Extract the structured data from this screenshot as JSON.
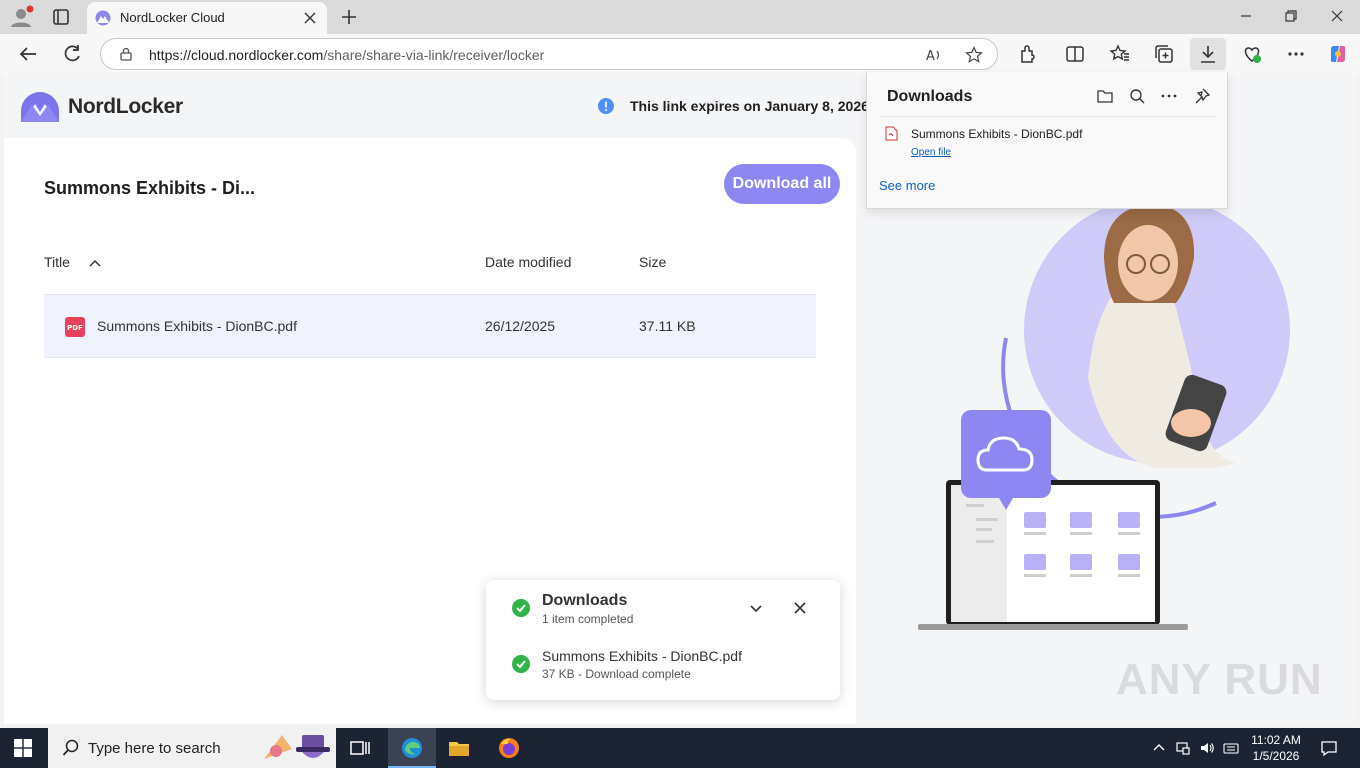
{
  "browser": {
    "tab_title": "NordLocker Cloud",
    "url_host": "https://cloud.nordlocker.com",
    "url_path": "/share/share-via-link/receiver/locker"
  },
  "page": {
    "brand": "NordLocker",
    "expiry_text": "This link expires on January 8, 2026",
    "folder_title": "Summons Exhibits - Di...",
    "download_all_label": "Download all",
    "columns": {
      "title": "Title",
      "date": "Date modified",
      "size": "Size"
    },
    "files": [
      {
        "icon_label": "PDF",
        "name": "Summons Exhibits - DionBC.pdf",
        "date": "26/12/2025",
        "size": "37.11 KB"
      }
    ]
  },
  "downloads_flyout": {
    "title": "Downloads",
    "file_name": "Summons Exhibits - DionBC.pdf",
    "open_file": "Open file",
    "see_more": "See more"
  },
  "toast": {
    "title": "Downloads",
    "subtitle": "1 item completed",
    "item_name": "Summons Exhibits - DionBC.pdf",
    "item_status": "37 KB - Download complete"
  },
  "watermark": "ANY RUN",
  "taskbar": {
    "search_placeholder": "Type here to search",
    "time": "11:02 AM",
    "date": "1/5/2026"
  },
  "colors": {
    "accent": "#8e87f2",
    "success": "#2eb24a",
    "pdf_red": "#e8425a",
    "link": "#0f5fbf"
  }
}
